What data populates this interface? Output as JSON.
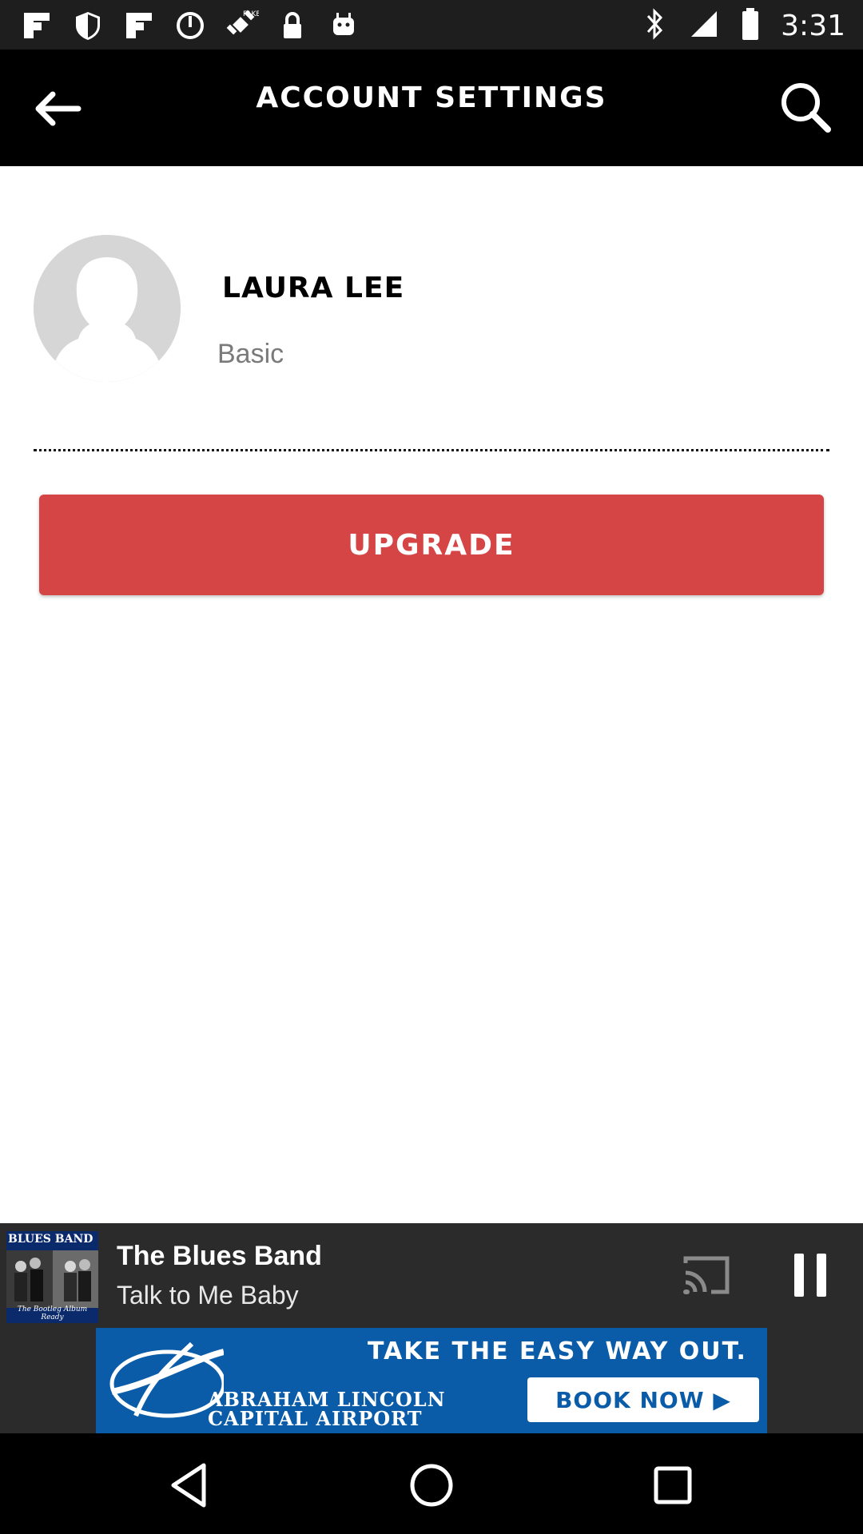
{
  "status_bar": {
    "time": "3:31",
    "left_icons": [
      "flipboard-icon",
      "shield-icon",
      "flipboard-icon",
      "sync-icon",
      "fake-gps-icon",
      "lock-icon",
      "android-icon"
    ],
    "right_icons": [
      "bluetooth-icon",
      "signal-icon",
      "battery-icon"
    ]
  },
  "header": {
    "title": "ACCOUNT SETTINGS",
    "back_icon": "back-arrow-icon",
    "search_icon": "search-icon"
  },
  "profile": {
    "name": "LAURA LEE",
    "plan": "Basic",
    "avatar_icon": "user-silhouette-icon"
  },
  "upgrade_button": {
    "label": "UPGRADE",
    "color": "#d64545"
  },
  "player": {
    "album_art": {
      "title": "BLUES BAND",
      "subtitle": "The Bootleg Album Ready"
    },
    "artist": "The Blues Band",
    "track": "Talk to Me Baby",
    "cast_icon": "cast-icon",
    "pause_icon": "pause-icon"
  },
  "ad": {
    "headline": "TAKE THE EASY WAY OUT.",
    "org": "ABRAHAM LINCOLN CAPITAL AIRPORT",
    "cta": "BOOK NOW ▶"
  },
  "nav_bar": {
    "icons": [
      "back-triangle-icon",
      "home-circle-icon",
      "recents-square-icon"
    ]
  }
}
